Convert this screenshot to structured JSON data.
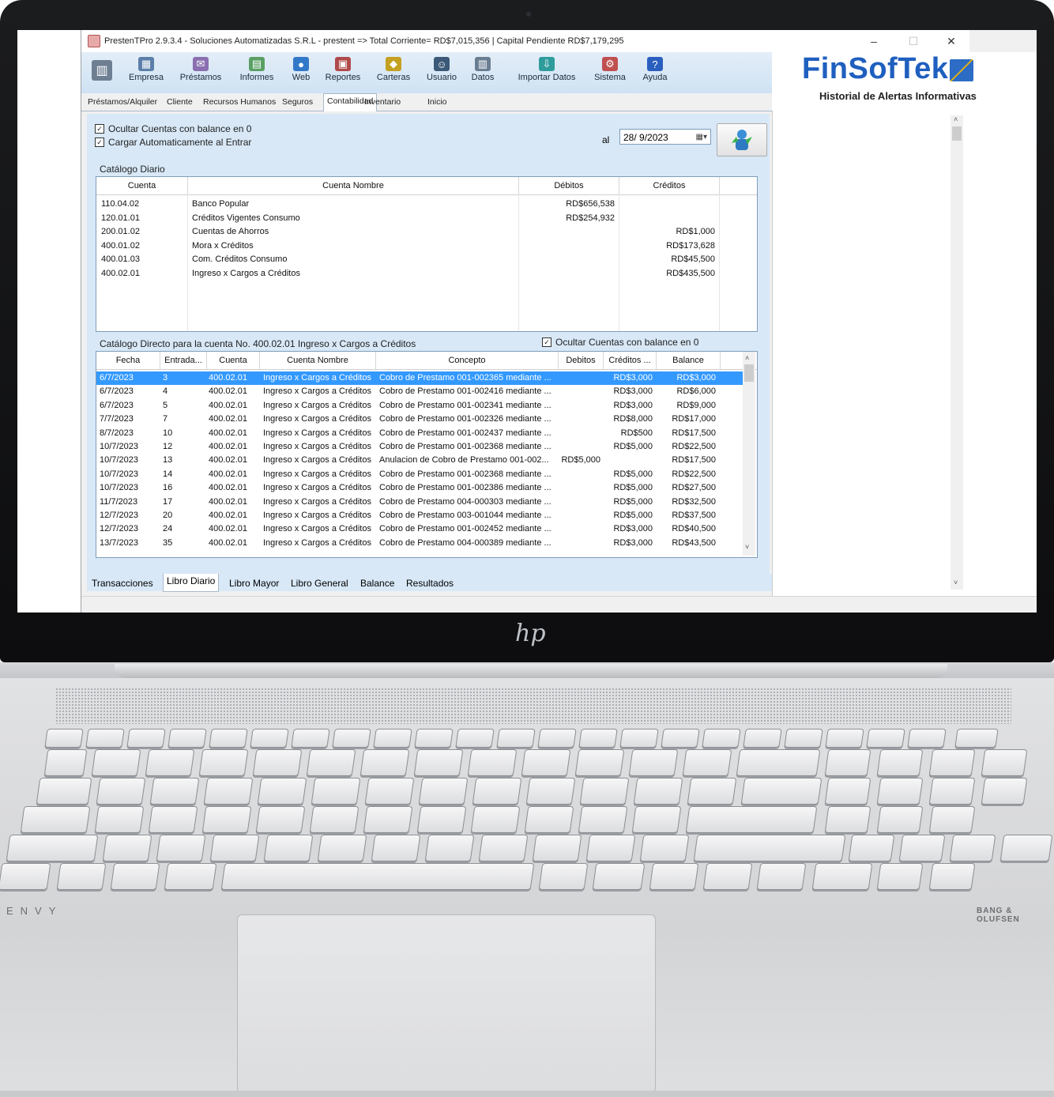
{
  "window": {
    "title": "PrestenTPro 2.9.3.4 - Soluciones Automatizadas S.R.L - prestent => Total Corriente= RD$7,015,356 | Capital Pendiente RD$7,179,295",
    "minimize": "–",
    "maximize": "☐",
    "close": "✕"
  },
  "toolbar": {
    "items": [
      {
        "label": "Empresa",
        "icon": "building-icon",
        "color": "#5b7fa8",
        "glyph": "▦"
      },
      {
        "label": "Préstamos",
        "icon": "loans-icon",
        "color": "#8a6fb0",
        "glyph": "✉"
      },
      {
        "label": "Informes",
        "icon": "reports-grid-icon",
        "color": "#5aa064",
        "glyph": "▤"
      },
      {
        "label": "Web",
        "icon": "globe-icon",
        "color": "#3278c8",
        "glyph": "●"
      },
      {
        "label": "Reportes",
        "icon": "printer-icon",
        "color": "#b04a4a",
        "glyph": "▣"
      },
      {
        "label": "Carteras",
        "icon": "portfolio-icon",
        "color": "#c4a020",
        "glyph": "◆"
      },
      {
        "label": "Usuario",
        "icon": "user-icon",
        "color": "#3c5a78",
        "glyph": "☺"
      },
      {
        "label": "Datos",
        "icon": "data-icon",
        "color": "#6a7e92",
        "glyph": "▥"
      },
      {
        "label": "Importar Datos",
        "icon": "import-icon",
        "color": "#2f9c9c",
        "glyph": "⇩"
      },
      {
        "label": "Sistema",
        "icon": "system-icon",
        "color": "#c05050",
        "glyph": "⚙"
      },
      {
        "label": "Ayuda",
        "icon": "help-icon",
        "color": "#2a5fbf",
        "glyph": "?"
      }
    ],
    "main_icon": "panel-icon"
  },
  "module_tabs": [
    "Préstamos/Alquiler",
    "Cliente",
    "Recursos Humanos",
    "Seguros",
    "Contabilidad",
    "Inventario",
    "Inicio"
  ],
  "filters": {
    "hide_zero": "Ocultar Cuentas con balance en 0",
    "auto_load": "Cargar Automaticamente al Entrar",
    "date_label": "al",
    "date_value": "28/ 9/2023"
  },
  "catalog": {
    "title": "Catálogo Diario",
    "headers": [
      "Cuenta",
      "Cuenta Nombre",
      "Débitos",
      "Créditos"
    ],
    "rows": [
      [
        "110.04.02",
        "Banco Popular",
        "RD$656,538",
        ""
      ],
      [
        "120.01.01",
        "Créditos Vigentes Consumo",
        "RD$254,932",
        ""
      ],
      [
        "200.01.02",
        "Cuentas de Ahorros",
        "",
        "RD$1,000"
      ],
      [
        "400.01.02",
        "Mora x Créditos",
        "",
        "RD$173,628"
      ],
      [
        "400.01.03",
        "Com. Créditos Consumo",
        "",
        "RD$45,500"
      ],
      [
        "400.02.01",
        "Ingreso x Cargos a Créditos",
        "",
        "RD$435,500"
      ]
    ]
  },
  "detail": {
    "title": "Catálogo Directo para la cuenta No. 400.02.01 Ingreso x Cargos a Créditos",
    "hide_zero": "Ocultar Cuentas con balance en 0",
    "headers": [
      "Fecha",
      "Entrada...",
      "Cuenta",
      "Cuenta Nombre",
      "Concepto",
      "Debitos",
      "Créditos ...",
      "Balance"
    ],
    "rows": [
      [
        "6/7/2023",
        "3",
        "400.02.01",
        "Ingreso x Cargos a Créditos",
        "Cobro de Prestamo 001-002365 mediante ...",
        "",
        "RD$3,000",
        "RD$3,000"
      ],
      [
        "6/7/2023",
        "4",
        "400.02.01",
        "Ingreso x Cargos a Créditos",
        "Cobro de Prestamo 001-002416 mediante ...",
        "",
        "RD$3,000",
        "RD$6,000"
      ],
      [
        "6/7/2023",
        "5",
        "400.02.01",
        "Ingreso x Cargos a Créditos",
        "Cobro de Prestamo 001-002341 mediante ...",
        "",
        "RD$3,000",
        "RD$9,000"
      ],
      [
        "7/7/2023",
        "7",
        "400.02.01",
        "Ingreso x Cargos a Créditos",
        "Cobro de Prestamo 001-002326 mediante ...",
        "",
        "RD$8,000",
        "RD$17,000"
      ],
      [
        "8/7/2023",
        "10",
        "400.02.01",
        "Ingreso x Cargos a Créditos",
        "Cobro de Prestamo 001-002437 mediante ...",
        "",
        "RD$500",
        "RD$17,500"
      ],
      [
        "10/7/2023",
        "12",
        "400.02.01",
        "Ingreso x Cargos a Créditos",
        "Cobro de Prestamo 001-002368 mediante ...",
        "",
        "RD$5,000",
        "RD$22,500"
      ],
      [
        "10/7/2023",
        "13",
        "400.02.01",
        "Ingreso x Cargos a Créditos",
        "Anulacion de Cobro de Prestamo 001-002...",
        "RD$5,000",
        "",
        "RD$17,500"
      ],
      [
        "10/7/2023",
        "14",
        "400.02.01",
        "Ingreso x Cargos a Créditos",
        "Cobro de Prestamo 001-002368 mediante ...",
        "",
        "RD$5,000",
        "RD$22,500"
      ],
      [
        "10/7/2023",
        "16",
        "400.02.01",
        "Ingreso x Cargos a Créditos",
        "Cobro de Prestamo 001-002386 mediante ...",
        "",
        "RD$5,000",
        "RD$27,500"
      ],
      [
        "11/7/2023",
        "17",
        "400.02.01",
        "Ingreso x Cargos a Créditos",
        "Cobro de Prestamo 004-000303 mediante ...",
        "",
        "RD$5,000",
        "RD$32,500"
      ],
      [
        "12/7/2023",
        "20",
        "400.02.01",
        "Ingreso x Cargos a Créditos",
        "Cobro de Prestamo 003-001044 mediante ...",
        "",
        "RD$5,000",
        "RD$37,500"
      ],
      [
        "12/7/2023",
        "24",
        "400.02.01",
        "Ingreso x Cargos a Créditos",
        "Cobro de Prestamo 001-002452 mediante ...",
        "",
        "RD$3,000",
        "RD$40,500"
      ],
      [
        "13/7/2023",
        "35",
        "400.02.01",
        "Ingreso x Cargos a Créditos",
        "Cobro de Prestamo 004-000389 mediante ...",
        "",
        "RD$3,000",
        "RD$43,500"
      ]
    ]
  },
  "bottom_tabs": [
    "Transacciones",
    "Libro Diario",
    "Libro Mayor",
    "Libro General",
    "Balance",
    "Resultados"
  ],
  "right_panel": {
    "logo": "FinSofTek",
    "title": "Historial de Alertas Informativas"
  },
  "laptop": {
    "logo": "hp",
    "brand_left": "ENVY",
    "brand_right": "BANG & OLUFSEN"
  }
}
